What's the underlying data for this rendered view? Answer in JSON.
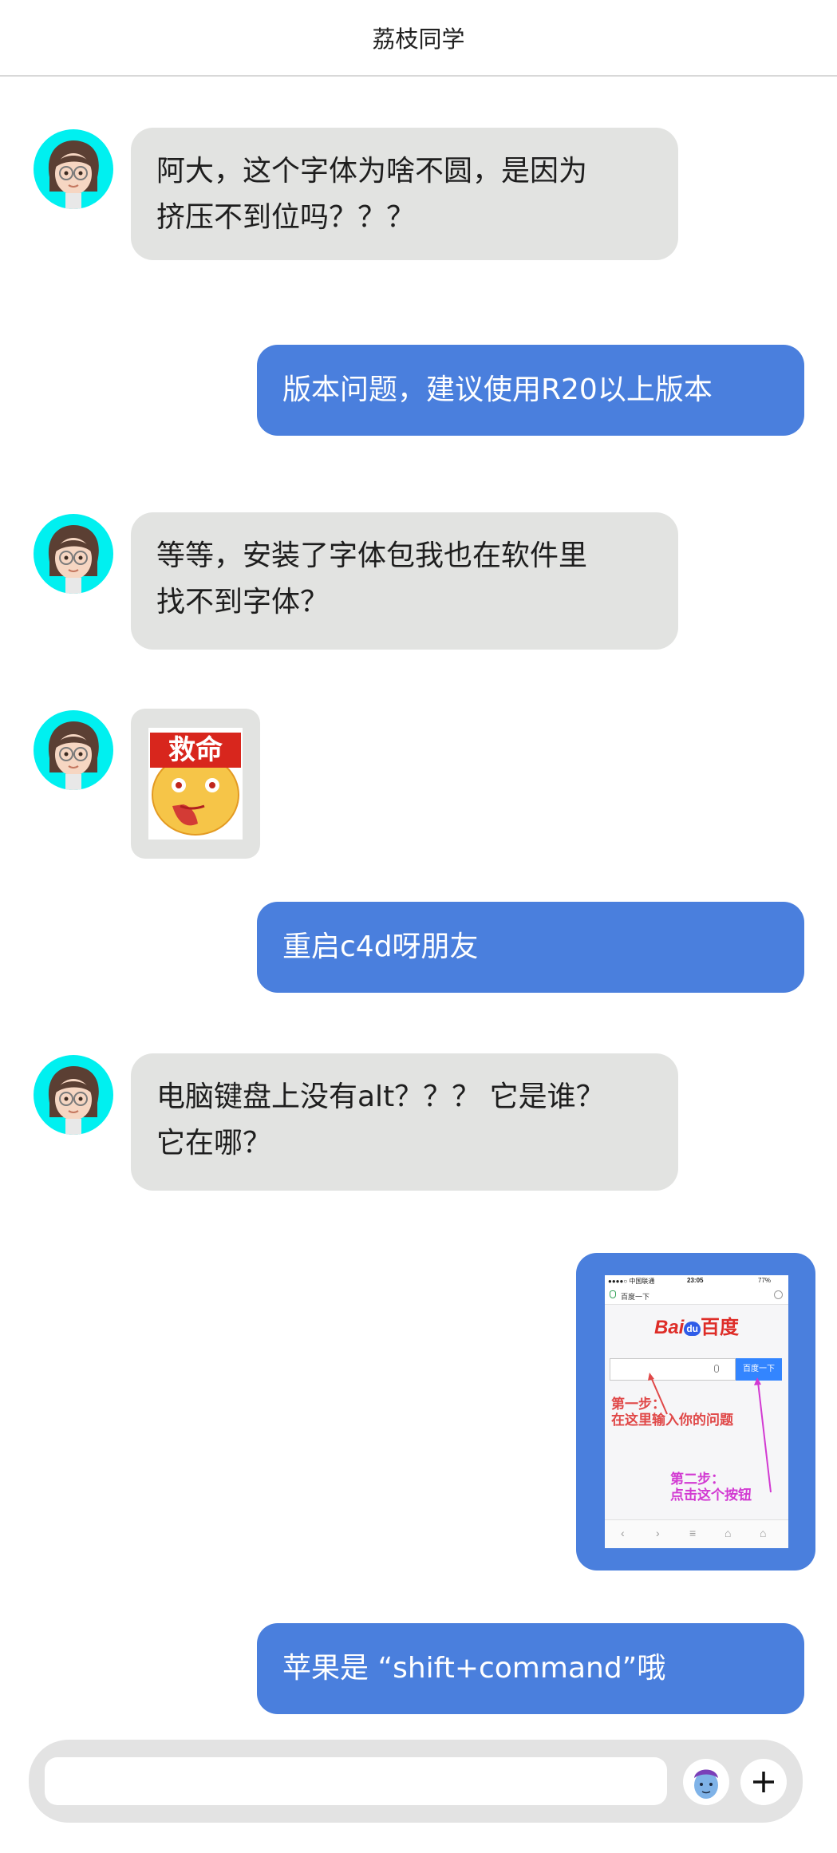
{
  "header": {
    "title": "荔枝同学"
  },
  "messages": [
    {
      "line1": "阿大，这个字体为啥不圆，是因为",
      "line2": "挤压不到位吗？？？"
    },
    {
      "text": "版本问题，建议使用R20以上版本"
    },
    {
      "line1": "等等，安装了字体包我也在软件里",
      "line2": "找不到字体？"
    },
    {
      "sticker_text": "救命"
    },
    {
      "text": "重启c4d呀朋友"
    },
    {
      "line1": "电脑键盘上没有alt？？？ 它是谁？",
      "line2": "它在哪？"
    },
    {
      "screenshot": {
        "carrier": "●●●●○ 中国联通",
        "time": "23:05",
        "battery": "77%",
        "url": "百度一下",
        "logo_left": "Bai",
        "logo_paw": "du",
        "logo_right": "百度",
        "search_button": "百度一下",
        "step1_title": "第一步：",
        "step1_text": "在这里输入你的问题",
        "step2_title": "第二步：",
        "step2_text": "点击这个按钮"
      }
    },
    {
      "text": "苹果是 “shift+command”哦"
    }
  ],
  "colors": {
    "outgoing": "#4a7fdd",
    "incoming": "#e2e3e1",
    "avatar_bg": "#00f0f0"
  }
}
